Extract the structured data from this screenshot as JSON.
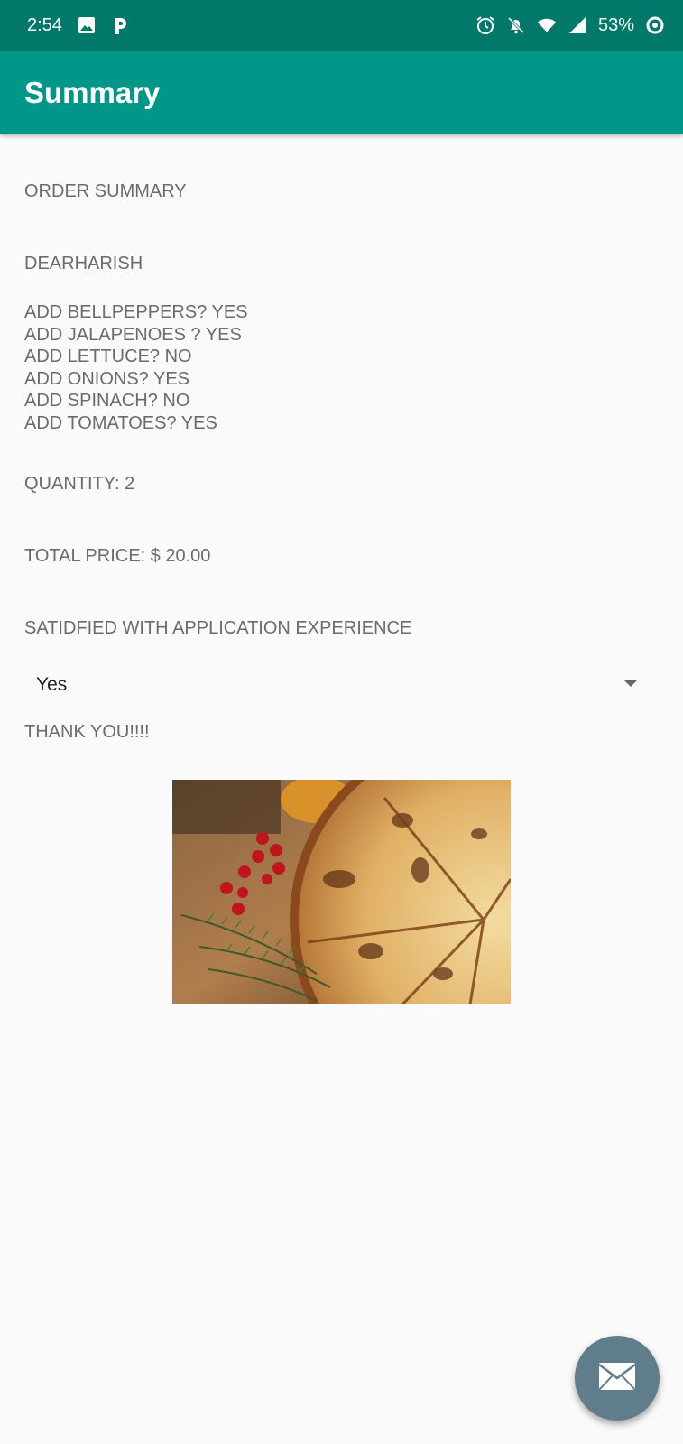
{
  "status_bar": {
    "time": "2:54",
    "battery": "53%",
    "icons_left": [
      "image-icon",
      "p-app-icon"
    ],
    "icons_right": [
      "alarm-icon",
      "notifications-off-icon",
      "wifi-icon",
      "signal-icon",
      "battery-icon"
    ]
  },
  "app_bar": {
    "title": "Summary",
    "color": "#009688"
  },
  "summary": {
    "heading": "ORDER SUMMARY",
    "greeting": "DEARHARISH",
    "toppings": [
      "ADD BELLPEPPERS? YES",
      "ADD JALAPENOES ? YES",
      "ADD LETTUCE? NO",
      "ADD ONIONS? YES",
      "ADD SPINACH? NO",
      "ADD TOMATOES? YES"
    ],
    "quantity": "QUANTITY: 2",
    "total_price": "TOTAL PRICE: $ 20.00",
    "satisfaction_label": "SATIDFIED WITH APPLICATION EXPERIENCE",
    "satisfaction_value": "Yes",
    "thanks": "THANK YOU!!!!"
  },
  "fab": {
    "icon": "email-icon",
    "color": "#607d8b"
  }
}
